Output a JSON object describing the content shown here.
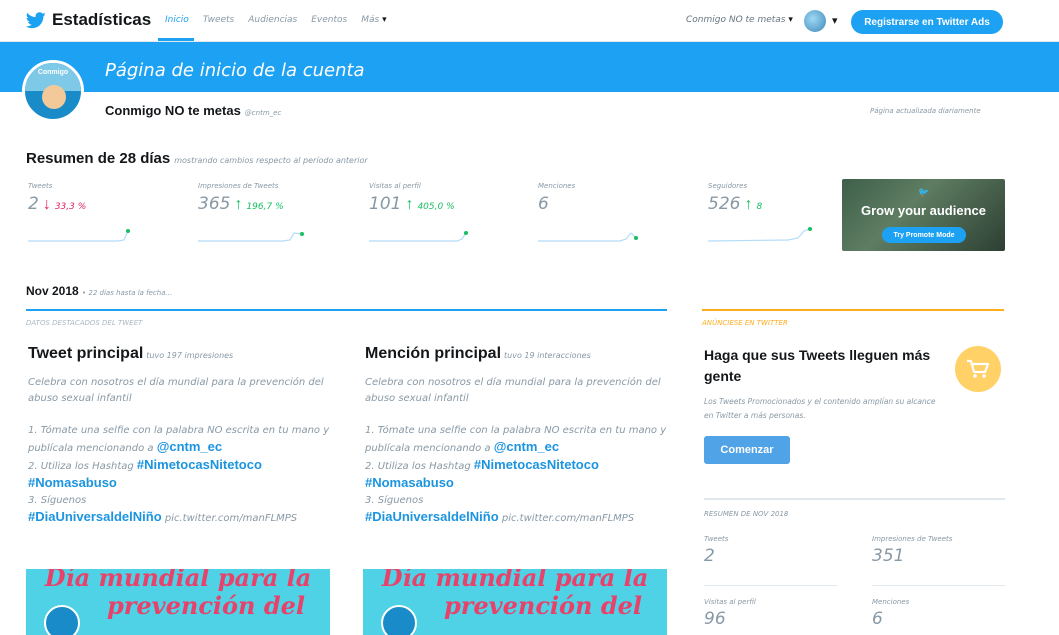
{
  "nav": {
    "brand": "Estadísticas",
    "links": [
      "Inicio",
      "Tweets",
      "Audiencias",
      "Eventos",
      "Más"
    ],
    "account_switch": "Conmigo NO te metas",
    "ads_button": "Registrarse en Twitter Ads"
  },
  "banner": {
    "title": "Página de inicio de la cuenta"
  },
  "account": {
    "name": "Conmigo NO te metas",
    "handle": "@cntm_ec",
    "updated": "Página actualizada diariamente",
    "pic_text": "Conmigo"
  },
  "summary": {
    "title": "Resumen de 28 días",
    "subtitle": "mostrando cambios respecto al período anterior",
    "stats": [
      {
        "label": "Tweets",
        "value": "2",
        "change": "33,3 %",
        "arrow": "↓",
        "direction": "down"
      },
      {
        "label": "Impresiones de Tweets",
        "value": "365",
        "change": "196,7 %",
        "arrow": "↑",
        "direction": "up"
      },
      {
        "label": "Visitas al perfil",
        "value": "101",
        "change": "405,0 %",
        "arrow": "↑",
        "direction": "up"
      },
      {
        "label": "Menciones",
        "value": "6",
        "change": "",
        "arrow": "",
        "direction": "none"
      },
      {
        "label": "Seguidores",
        "value": "526",
        "change": "8",
        "arrow": "↑",
        "direction": "up"
      }
    ]
  },
  "promo_card": {
    "title": "Grow your audience",
    "button": "Try Promote Mode"
  },
  "month": {
    "title": "Nov 2018",
    "subtitle": "• 22 días hasta la fecha...",
    "highlights_label": "DATOS DESTACADOS DEL TWEET",
    "ads_label": "ANÚNCIESE EN TWITTER"
  },
  "top_tweet": {
    "title": "Tweet principal",
    "subtitle": "tuvo 197 impresiones",
    "line1": "Celebra con nosotros el día mundial para la prevención del",
    "line2": "abuso sexual infantil",
    "line3": "1. Tómate una selfie con la palabra NO escrita en tu mano y",
    "line4a": "publícala mencionando a ",
    "mention": "@cntm_ec",
    "line5a": "2. Utiliza los Hashtag ",
    "hashtag1": "#NimetocasNitetoco",
    "hashtag2": "#Nomasabuso",
    "line6": "3. Síguenos",
    "hashtag3": "#DiaUniversaldelNiño",
    "pic_link": "pic.twitter.com/manFLMPS",
    "image_line1": "Día mundial para la",
    "image_line2": "prevención del"
  },
  "top_mention": {
    "title": "Mención principal",
    "subtitle": "tuvo 19 interacciones",
    "line1": "Celebra con nosotros el día mundial para la prevención del",
    "line2": "abuso sexual infantil",
    "line3": "1. Tómate una selfie con la palabra NO escrita en tu mano y",
    "line4a": "publícala mencionando a ",
    "mention": "@cntm_ec",
    "line5a": "2. Utiliza los Hashtag ",
    "hashtag1": "#NimetocasNitetoco",
    "hashtag2": "#Nomasabuso",
    "line6": "3. Síguenos",
    "hashtag3": "#DiaUniversaldelNiño",
    "pic_link": "pic.twitter.com/manFLMPS",
    "image_line1": "Día mundial para la",
    "image_line2": "prevención del"
  },
  "ads_promo": {
    "title": "Haga que sus Tweets lleguen más gente",
    "description": "Los Tweets Promocionados y el contenido amplían su alcance en Twitter a más personas.",
    "button": "Comenzar"
  },
  "month_summary": {
    "label": "RESUMEN DE NOV 2018",
    "items": [
      {
        "label": "Tweets",
        "value": "2"
      },
      {
        "label": "Impresiones de Tweets",
        "value": "351"
      },
      {
        "label": "Visitas al perfil",
        "value": "96"
      },
      {
        "label": "Menciones",
        "value": "6"
      }
    ]
  },
  "colors": {
    "brand_blue": "#1da1f2",
    "up_green": "#17bf63",
    "down_red": "#e0245e",
    "ads_orange": "#ffad1f"
  }
}
